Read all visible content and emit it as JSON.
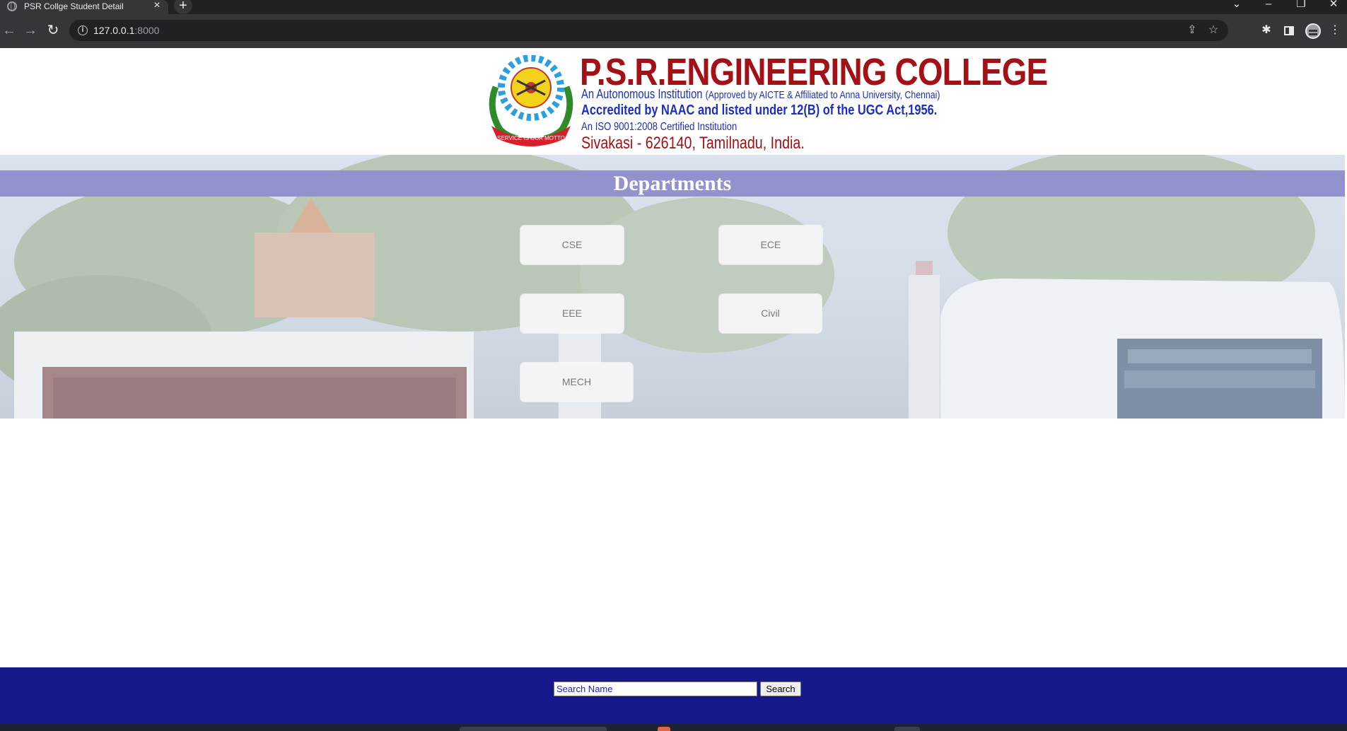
{
  "browser": {
    "tab_title": "PSR Collge Student Detail",
    "tab_close": "×",
    "new_tab": "+",
    "url_host": "127.0.0.1",
    "url_port": ":8000",
    "icons": [
      "close-icon",
      "plus-icon",
      "back-icon",
      "forward-icon",
      "reload-icon",
      "info-icon",
      "share-icon",
      "star-icon",
      "extensions-icon",
      "side-panel-icon",
      "profile-icon",
      "menu-icon"
    ]
  },
  "header": {
    "college_name": "P.S.R.ENGINEERING COLLEGE",
    "line_autonomous": "An Autonomous Institution",
    "line_approved": "(Approved by AICTE & Affiliated to Anna University, Chennai)",
    "line_naac": "Accredited by NAAC and listed under 12(B) of the UGC Act,1956.",
    "line_iso": "An ISO 9001:2008 Certified Institution",
    "line_place": "Sivakasi - 626140, Tamilnadu, India.",
    "emblem_motto": "SERVICE IS OUR MOTTO"
  },
  "departments": {
    "title": "Departments",
    "items": [
      {
        "label": "CSE"
      },
      {
        "label": "ECE"
      },
      {
        "label": "EEE"
      },
      {
        "label": "Civil"
      },
      {
        "label": "MECH"
      }
    ]
  },
  "footer": {
    "search_placeholder": "Search Name",
    "search_button": "Search"
  },
  "colors": {
    "college_red": "#a31016",
    "college_blue": "#1c2fbf",
    "dept_bar": "#9292cf",
    "footer_bg": "#16188c",
    "chrome_dark": "#202124",
    "chrome_toolbar": "#35363a"
  }
}
